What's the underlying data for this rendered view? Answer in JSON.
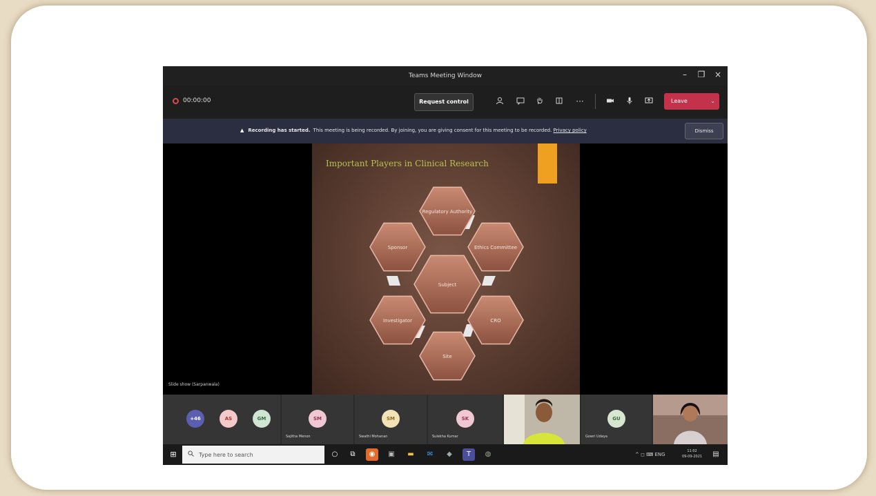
{
  "window": {
    "title": "Teams Meeting Window",
    "controls": {
      "minimize": "–",
      "maximize": "❐",
      "close": "×"
    }
  },
  "toolbar": {
    "timer": "00:00:00",
    "request_control": "Request control",
    "leave_label": "Leave",
    "leave_chevron": "⌄",
    "icons": [
      "people-icon",
      "chat-icon",
      "raise-hand-icon",
      "rooms-icon",
      "more-icon",
      "camera-icon",
      "mic-icon",
      "share-icon"
    ]
  },
  "banner": {
    "warning_glyph": "▲",
    "bold": "Recording has started.",
    "message": "This meeting is being recorded. By joining, you are giving consent for this meeting to be recorded.",
    "link": "Privacy policy",
    "dismiss": "Dismiss"
  },
  "slide": {
    "title": "Important Players in Clinical Research",
    "hexagons": [
      {
        "label": "Regulatory Authority"
      },
      {
        "label": "Ethics Committee"
      },
      {
        "label": "CRO"
      },
      {
        "label": "Site"
      },
      {
        "label": "Investigator"
      },
      {
        "label": "Sponsor"
      },
      {
        "label": "Subject"
      }
    ],
    "accent_color": "#f0a020",
    "title_color": "#b6c24e"
  },
  "presenter": "Slide show (Sarpanwala)",
  "participants": [
    {
      "initials": "+46",
      "color": "#5a5fb0",
      "text_color": "#ffffff",
      "name": ""
    },
    {
      "initials": "AS",
      "color": "#f4c9c9",
      "text_color": "#a33",
      "name": ""
    },
    {
      "initials": "GM",
      "color": "#cfe6d2",
      "text_color": "#3a6a44",
      "name": ""
    },
    {
      "initials": "SM",
      "color": "#f0c8d4",
      "text_color": "#9a3050",
      "name": "Sajitha Menon"
    },
    {
      "initials": "SM",
      "color": "#f3e2b5",
      "text_color": "#8a6a20",
      "name": "Swathi Mohanan"
    },
    {
      "initials": "SK",
      "color": "#f0c8d4",
      "text_color": "#9a3050",
      "name": "Sulekha Kumar"
    },
    {
      "initials": "GU",
      "color": "#d6e6d0",
      "text_color": "#3a6a44",
      "name": "Gowri Udaya"
    }
  ],
  "taskbar": {
    "start_glyph": "⊞",
    "search_placeholder": "Type here to search",
    "time": "11:02",
    "date": "09-09-2021",
    "tray": "^ ◻ ⌨ ENG"
  }
}
